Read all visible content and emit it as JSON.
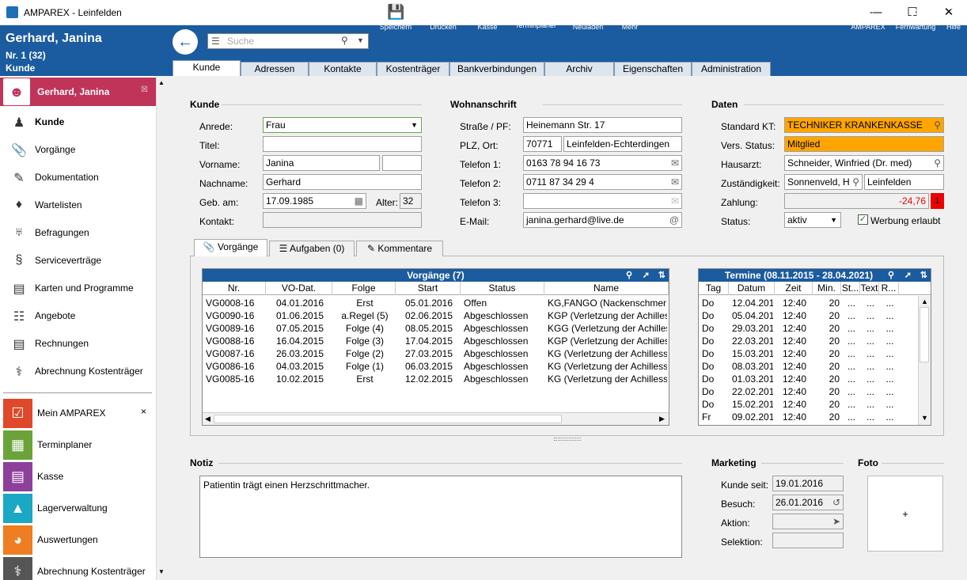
{
  "window": {
    "title": "AMPAREX - Leinfelden"
  },
  "header": {
    "customer_name": "Gerhard, Janina",
    "customer_no": "Nr. 1 (32)",
    "context": "Kunde"
  },
  "toolbar": {
    "search_placeholder": "Suche",
    "buttons": [
      "Speichern",
      "Drucken",
      "Kasse",
      "Terminplaner",
      "Neuladen",
      "Mehr"
    ],
    "right_buttons": [
      "AMPAREX",
      "Fernwartung",
      "Hilfe"
    ],
    "calendar_day": "3"
  },
  "tabs": [
    "Kunde",
    "Adressen",
    "Kontakte",
    "Kostenträger",
    "Bankverbindungen",
    "Archiv",
    "Eigenschaften",
    "Administration"
  ],
  "sidebar": {
    "customer": "Gerhard, Janina",
    "items": [
      "Kunde",
      "Vorgänge",
      "Dokumentation",
      "Wartelisten",
      "Befragungen",
      "Serviceverträge",
      "Karten und Programme",
      "Angebote",
      "Rechnungen",
      "Abrechnung Kostenträger"
    ],
    "modules": [
      "Mein AMPAREX",
      "Terminplaner",
      "Kasse",
      "Lagerverwaltung",
      "Auswertungen",
      "Abrechnung Kostenträger"
    ]
  },
  "kunde": {
    "title": "Kunde",
    "anrede_label": "Anrede:",
    "anrede": "Frau",
    "titel_label": "Titel:",
    "titel": "",
    "vorname_label": "Vorname:",
    "vorname": "Janina",
    "nachname_label": "Nachname:",
    "nachname": "Gerhard",
    "geb_label": "Geb. am:",
    "geb": "17.09.1985",
    "alter_label": "Alter:",
    "alter": "32",
    "kontakt_label": "Kontakt:"
  },
  "wohn": {
    "title": "Wohnanschrift",
    "strasse_label": "Straße / PF:",
    "strasse": "Heinemann Str. 17",
    "plz_label": "PLZ, Ort:",
    "plz": "70771",
    "ort": "Leinfelden-Echterdingen",
    "tel1_label": "Telefon 1:",
    "tel1": "0163 78 94 16 73",
    "tel2_label": "Telefon 2:",
    "tel2": "0711 87 34 29 4",
    "tel3_label": "Telefon 3:",
    "tel3": "",
    "email_label": "E-Mail:",
    "email": "janina.gerhard@live.de"
  },
  "daten": {
    "title": "Daten",
    "kt_label": "Standard KT:",
    "kt": "TECHNIKER KRANKENKASSE",
    "vers_label": "Vers. Status:",
    "vers": "Mitglied",
    "arzt_label": "Hausarzt:",
    "arzt": "Schneider, Winfried (Dr. med)",
    "zust_label": "Zuständigkeit:",
    "zust": "Sonnenveld, H",
    "zust_ort": "Leinfelden",
    "zahl_label": "Zahlung:",
    "zahl": "-24,76",
    "zahl_badge": "1",
    "status_label": "Status:",
    "status": "aktiv",
    "werbung": "Werbung erlaubt"
  },
  "subtabs": [
    "Vorgänge",
    "Aufgaben (0)",
    "Kommentare"
  ],
  "vorgaenge": {
    "title": "Vorgänge (7)",
    "columns": [
      "Nr.",
      "VO-Dat.",
      "Folge",
      "Start",
      "Status",
      "Name"
    ],
    "rows": [
      [
        "VG0008-16",
        "04.01.2016",
        "Erst",
        "05.01.2016",
        "Offen",
        "KG,FANGO (Nackenschmer"
      ],
      [
        "VG0090-16",
        "01.06.2015",
        "a.Regel (5)",
        "02.06.2015",
        "Abgeschlossen",
        "KGP (Verletzung der Achilles"
      ],
      [
        "VG0089-16",
        "07.05.2015",
        "Folge (4)",
        "08.05.2015",
        "Abgeschlossen",
        "KGG (Verletzung der Achilles"
      ],
      [
        "VG0088-16",
        "16.04.2015",
        "Folge (3)",
        "17.04.2015",
        "Abgeschlossen",
        "KGP (Verletzung der Achilles"
      ],
      [
        "VG0087-16",
        "26.03.2015",
        "Folge (2)",
        "27.03.2015",
        "Abgeschlossen",
        "KG (Verletzung der Achilless"
      ],
      [
        "VG0086-16",
        "04.03.2015",
        "Folge (1)",
        "06.03.2015",
        "Abgeschlossen",
        "KG (Verletzung der Achilless"
      ],
      [
        "VG0085-16",
        "10.02.2015",
        "Erst",
        "12.02.2015",
        "Abgeschlossen",
        "KG (Verletzung der Achilless"
      ]
    ]
  },
  "termine": {
    "title": "Termine (08.11.2015 - 28.04.2021)",
    "columns": [
      "Tag",
      "Datum",
      "Zeit",
      "Min.",
      "St...",
      "Text",
      "R..."
    ],
    "rows": [
      [
        "Do",
        "12.04.2018",
        "12:40",
        "20",
        "...",
        "...",
        "..."
      ],
      [
        "Do",
        "05.04.2018",
        "12:40",
        "20",
        "...",
        "...",
        "..."
      ],
      [
        "Do",
        "29.03.2018",
        "12:40",
        "20",
        "...",
        "...",
        "..."
      ],
      [
        "Do",
        "22.03.2018",
        "12:40",
        "20",
        "...",
        "...",
        "..."
      ],
      [
        "Do",
        "15.03.2018",
        "12:40",
        "20",
        "...",
        "...",
        "..."
      ],
      [
        "Do",
        "08.03.2018",
        "12:40",
        "20",
        "...",
        "...",
        "..."
      ],
      [
        "Do",
        "01.03.2018",
        "12:40",
        "20",
        "...",
        "...",
        "..."
      ],
      [
        "Do",
        "22.02.2018",
        "12:40",
        "20",
        "...",
        "...",
        "..."
      ],
      [
        "Do",
        "15.02.2018",
        "12:40",
        "20",
        "...",
        "...",
        "..."
      ],
      [
        "Fr",
        "09.02.2018",
        "12:40",
        "20",
        "...",
        "...",
        "..."
      ]
    ]
  },
  "notiz": {
    "title": "Notiz",
    "text": "Patientin trägt einen Herzschrittmacher."
  },
  "marketing": {
    "title": "Marketing",
    "seit_label": "Kunde seit:",
    "seit": "19.01.2016",
    "besuch_label": "Besuch:",
    "besuch": "26.01.2016",
    "aktion_label": "Aktion:",
    "selektion_label": "Selektion:"
  },
  "foto": {
    "title": "Foto",
    "add": "+"
  },
  "colors": {
    "brand": "#1b5b9f",
    "customer": "#c0345a",
    "orange": "#ffa500"
  }
}
